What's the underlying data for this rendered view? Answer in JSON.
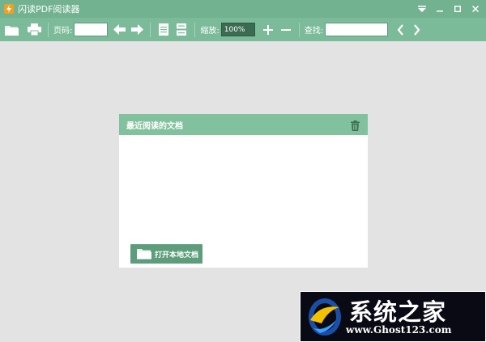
{
  "app": {
    "title": "闪读PDF阅读器"
  },
  "toolbar": {
    "page_label": "页码:",
    "page_value": "",
    "zoom_label": "缩放:",
    "zoom_value": "100%",
    "search_label": "查找:",
    "search_value": ""
  },
  "recent": {
    "title": "最近阅读的文档",
    "open_button": "打开本地文档"
  },
  "watermark": {
    "brand": "系统之家",
    "url": "www.Ghost123.com"
  },
  "colors": {
    "titlebar": "#72b290",
    "toolbar": "#7bbb99",
    "panel_header": "#82c19e",
    "button": "#5e9d7c",
    "background": "#e3e3e3"
  }
}
